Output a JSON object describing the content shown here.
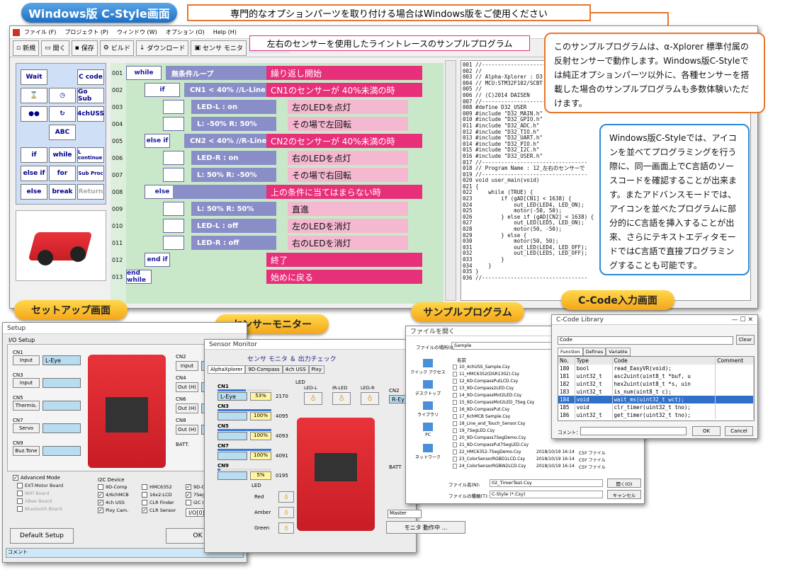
{
  "main_title": "Windows版 C-Style画面",
  "top_banner": "専門的なオプションパーツを取り付ける場合はWindows版をご使用ください",
  "sample_banner": "左右のセンサーを使用したライントレースのサンプルプログラム",
  "callout_orange": "このサンプルプログラムは、α-Xplorer 標準付属の反射センサーで動作します。Windows版C-Styleでは純正オプションパーツ以外に、各種センサーを搭載した場合のサンプルプログラムも多数体験いただけます。",
  "callout_blue": "Windows版C-Styleでは、アイコンを並べてプログラミングを行う際に、同一画面上でC言語のソースコードを確認することが出来ます。またアドバンスモードでは、アイコンを並べたプログラムに部分的にC言語を挿入することが出来、さらにテキストエディタモードではC言語で直接プログラミングすることも可能です。",
  "menu": [
    "ファイル (F)",
    "プロジェクト (P)",
    "ウィンドウ (W)",
    "オプション (O)",
    "Help (H)"
  ],
  "toolbar": [
    "新規",
    "開く",
    "保存",
    "ビルド",
    "ダウンロード",
    "センサ モニタ"
  ],
  "path": "C:¥Daisen",
  "palette": [
    "Wait",
    "C code",
    "",
    "",
    "Go Sub",
    "",
    "",
    "ABC",
    "4chUSS",
    "if",
    "while",
    "L continue",
    "else if",
    "for",
    "Sub Proc",
    "else",
    "break",
    "Return"
  ],
  "rows": [
    {
      "n": "001",
      "block": "while",
      "label": "無条件ループ",
      "note": "繰り返し開始",
      "pink": "dark"
    },
    {
      "n": "002",
      "block": "if",
      "label": "CN1 < 40% //L-Line",
      "note": "CN1のセンサーが 40%未満の時",
      "pink": "dark"
    },
    {
      "n": "003",
      "block": "",
      "label": "LED-L : on",
      "note": "左のLEDを点灯",
      "pink": "light"
    },
    {
      "n": "004",
      "block": "",
      "label": "L: -50%  R: 50%",
      "note": "その場で左回転",
      "pink": "light"
    },
    {
      "n": "005",
      "block": "else if",
      "label": "CN2 < 40% //R-Line",
      "note": "CN2のセンサーが 40%未満の時",
      "pink": "dark"
    },
    {
      "n": "006",
      "block": "",
      "label": "LED-R : on",
      "note": "右のLEDを点灯",
      "pink": "light"
    },
    {
      "n": "007",
      "block": "",
      "label": "L:  50%  R: -50%",
      "note": "その場で右回転",
      "pink": "light"
    },
    {
      "n": "008",
      "block": "else",
      "label": "",
      "note": "上の条件に当てはまらない時",
      "pink": "dark"
    },
    {
      "n": "009",
      "block": "",
      "label": "L:  50%  R: 50%",
      "note": "直進",
      "pink": "light"
    },
    {
      "n": "010",
      "block": "",
      "label": "LED-L : off",
      "note": "左のLEDを消灯",
      "pink": "light"
    },
    {
      "n": "011",
      "block": "",
      "label": "LED-R : off",
      "note": "右のLEDを消灯",
      "pink": "light"
    },
    {
      "n": "012",
      "block": "end if",
      "label": "",
      "note": "終了",
      "pink": "dark"
    },
    {
      "n": "013",
      "block": "end while",
      "label": "",
      "note": "始めに戻る",
      "pink": "dark"
    }
  ],
  "code_lines": "001 //---------------------------------\n002 //\n003 // Alpha-Xplorer : D3\n004 // MCU:STM32F102/SCBT\n005 //\n006 // (C)2014 DAISEN\n007 //---------------------------------\n008 #define D32_USER\n009 #include \"D32_MAIN.h\"\n010 #include \"D32_GPIO.h\"\n011 #include \"D32_ADC.h\"\n012 #include \"D32_TIO.h\"\n013 #include \"D32_UART.h\"\n014 #include \"D32_PIO.h\"\n015 #include \"D32_I2C.h\"\n016 #include \"D32_USER.h\"\n017 //---------------------------------\n018 // Program Name : 12_左右のセンサーで\n019 //---------------------------------\n020 void user_main(void)\n021 {\n022     while (TRUE) {\n023         if (gAD[CN1] < 1638) {\n024             out_LED(LED4, LED_ON);\n025             motor(-50, 50);\n026         } else if (gAD[CN2] < 1638) {\n027             out_LED(LED5, LED_ON);\n028             motor(50, -50);\n029         } else {\n030             motor(50, 50);\n031             out_LED(LED4, LED_OFF);\n032             out_LED(LED5, LED_OFF);\n033         }\n034     }\n035 }\n036 //---------------------------------",
  "labels": {
    "setup": "セットアップ画面",
    "monitor": "センサーモニター",
    "sample": "サンプルプログラム",
    "ccode": "C-Code入力画面"
  },
  "setup": {
    "title": "Setup",
    "io": "I/O Setup",
    "cn": [
      "CN1",
      "CN3",
      "CN5",
      "CN7",
      "CN9"
    ],
    "cn_vals": [
      "Input",
      "Input",
      "Thermis.",
      "Servo",
      "Buz.Tone"
    ],
    "cn1_field": "L-Eye",
    "cn_r": [
      "CN2",
      "CN4",
      "CN6",
      "CN8"
    ],
    "cn_r_vals": [
      "Input",
      "Out (H)",
      "Out (H)",
      "Out (H)"
    ],
    "batt": "BATT.",
    "adv": "Advanced Mode",
    "opts": [
      "EXT-Motor Board",
      "WiFi Board",
      "XBee Board",
      "Bluetooth Board"
    ],
    "i2c": "I2C Device",
    "i2c_opts": [
      "9D-Comp",
      "4/6chMCB",
      "4ch USS",
      "Pixy Cam.",
      "HMC6352",
      "16x2:LCD",
      "CLR Finder",
      "CLR Sensor",
      "9D-Comp",
      "7Seg LED",
      "I2C I/O"
    ],
    "i2c_addr": "I/O[0]",
    "default": "Default Setup",
    "ok": "OK",
    "comment": "コメント"
  },
  "monitor": {
    "title": "Sensor Monitor",
    "header": "センサ モニタ ＆ 出力チェック",
    "tabs": [
      "AlphaXplorer",
      "9D-Compass",
      "4ch USS",
      "Pixy"
    ],
    "cn": [
      {
        "n": "CN1",
        "name": "L-Eye",
        "pct": "53%",
        "v": "2170",
        "fill": 0.53
      },
      {
        "n": "CN3",
        "name": "",
        "pct": "100%",
        "v": "4095",
        "fill": 1
      },
      {
        "n": "CN5",
        "name": "",
        "pct": "100%",
        "v": "4093",
        "fill": 1
      },
      {
        "n": "CN7",
        "name": "",
        "pct": "100%",
        "v": "4091",
        "fill": 1
      },
      {
        "n": "CN9",
        "name": "",
        "pct": "5%",
        "v": "0195",
        "fill": 0.05
      }
    ],
    "led": "LED",
    "leds": [
      "LED-L",
      "IR-LED",
      "LED-R"
    ],
    "led2": "LED",
    "colors": [
      "Red",
      "Amber",
      "Green"
    ],
    "cn2": "CN2",
    "cn2_name": "R-Ey",
    "batt": "BATT",
    "master": "Master",
    "status": "モニタ 動作中 ..."
  },
  "sample": {
    "title": "ファイルを開く",
    "loc_label": "ファイルの場所(I):",
    "loc": "Sample",
    "name_col": "名前",
    "side": [
      "クイック アクセス",
      "デスクトップ",
      "ライブラリ",
      "PC",
      "ネットワーク"
    ],
    "files": [
      "10_4chUSS_Sample.Csy",
      "11_HMC6352(DSR1302).Csy",
      "12_6D-CompassPutLCD.Csy",
      "13_9D-Compass2LED.Csy",
      "14_9D-CompassMot2LED.Csy",
      "15_9D-CompassMot2LED_7Seg.Csy",
      "16_9D-CompassPut.Csy",
      "17_6chMCB Sample.Csy",
      "18_Line_and_Touch_Sensor.Csy",
      "19_7SegLED.Csy",
      "20_9D-Compass7SegDemo.Csy",
      "21_9D-CompassPut7SegLED.Csy",
      "22_HMC6352-7SegDemo.Csy",
      "23_ColorSensorRGBD1LCD.Csy",
      "24_ColorSensorRGBW2LCD.Csy"
    ],
    "dates": [
      "2018/10/19 16:14",
      "2018/10/19 16:14",
      "2018/10/19 16:14"
    ],
    "types": [
      "CSY ファイル",
      "CSY ファイル",
      "CSY ファイル"
    ],
    "fname_label": "ファイル名(N):",
    "fname": "02_TimerTest.Csy",
    "ftype_label": "ファイルの種類(T):",
    "ftype": "C-Style (*.Csy)",
    "open": "開く(O)",
    "cancel": "キャンセル"
  },
  "ccode": {
    "title": "C-Code Library",
    "code_label": "Code",
    "clear": "Clear",
    "tabs": [
      "Function",
      "Defines",
      "Variable"
    ],
    "cols": [
      "No.",
      "Type",
      "Code",
      "Comment"
    ],
    "rows": [
      [
        "180",
        "bool",
        "read_EasyVR(void);",
        ""
      ],
      [
        "181",
        "uint32_t",
        "asc2uint(uint8_t *buf, u",
        ""
      ],
      [
        "182",
        "uint32_t",
        "hex2uint(uint8_t *s, uin",
        ""
      ],
      [
        "183",
        "uint32_t",
        "is_num(uint8_t c);",
        ""
      ],
      [
        "184",
        "void",
        "wait_ms(uint32_t wct);",
        ""
      ],
      [
        "185",
        "void",
        "clr_timer(uint32_t tno);",
        ""
      ],
      [
        "186",
        "uint32_t",
        "get_timer(uint32_t tno);",
        ""
      ]
    ],
    "comment": "コメント：",
    "ok": "OK",
    "cancel": "Cancel"
  }
}
